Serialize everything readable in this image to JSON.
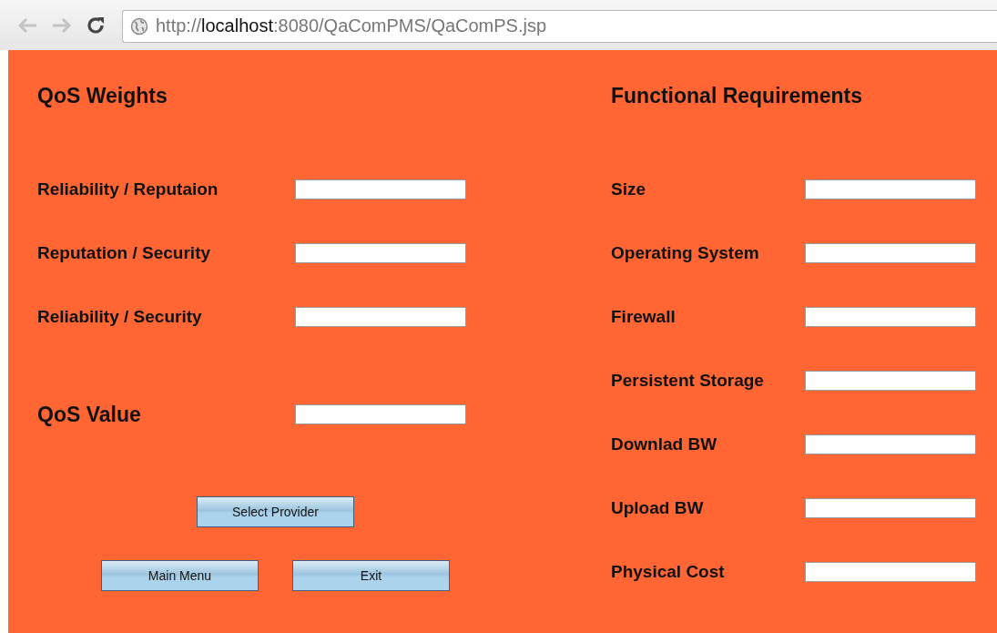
{
  "address_bar": {
    "scheme": "http://",
    "host": "localhost",
    "path": ":8080/QaComPMS/QaComPS.jsp"
  },
  "qos_weights": {
    "title": "QoS Weights",
    "fields": [
      {
        "label": "Reliability / Reputaion"
      },
      {
        "label": "Reputation / Security"
      },
      {
        "label": "Reliability / Security"
      }
    ],
    "value_label": "QoS Value"
  },
  "buttons": [
    {
      "label": "Select Provider"
    },
    {
      "label": "Main Menu"
    },
    {
      "label": "Exit"
    }
  ],
  "functional_requirements": {
    "title": "Functional Requirements",
    "fields": [
      {
        "label": "Size"
      },
      {
        "label": "Operating System"
      },
      {
        "label": "Firewall"
      },
      {
        "label": "Persistent Storage"
      },
      {
        "label": "Downlad BW"
      },
      {
        "label": "Upload BW"
      },
      {
        "label": "Physical Cost"
      }
    ]
  }
}
